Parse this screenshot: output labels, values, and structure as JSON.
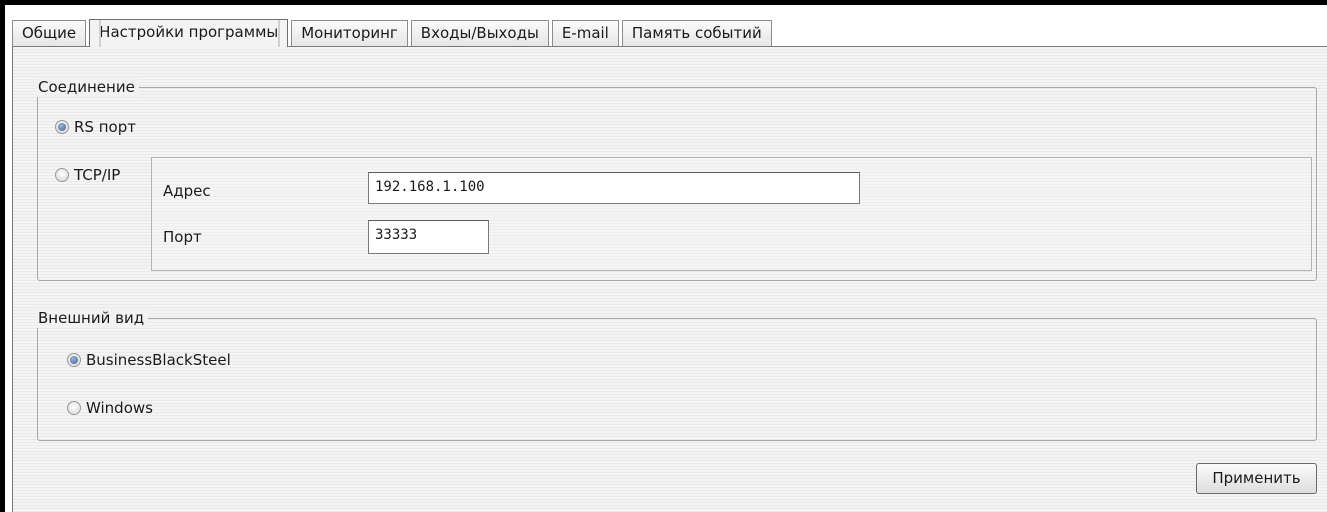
{
  "tabs": [
    {
      "label": "Общие"
    },
    {
      "label": "Настройки программы"
    },
    {
      "label": "Мониторинг"
    },
    {
      "label": "Входы/Выходы"
    },
    {
      "label": "E-mail"
    },
    {
      "label": "Память событий"
    }
  ],
  "active_tab": "Настройки программы",
  "connection": {
    "title": "Соединение",
    "rs_label": "RS порт",
    "rs_selected": true,
    "tcp_label": "TCP/IP",
    "tcp_selected": false,
    "address_label": "Адрес",
    "address_value": "192.168.1.100",
    "port_label": "Порт",
    "port_value": "33333"
  },
  "appearance": {
    "title": "Внешний вид",
    "option1_label": "BusinessBlackSteel",
    "option1_selected": true,
    "option2_label": "Windows",
    "option2_selected": false
  },
  "apply_label": "Применить"
}
